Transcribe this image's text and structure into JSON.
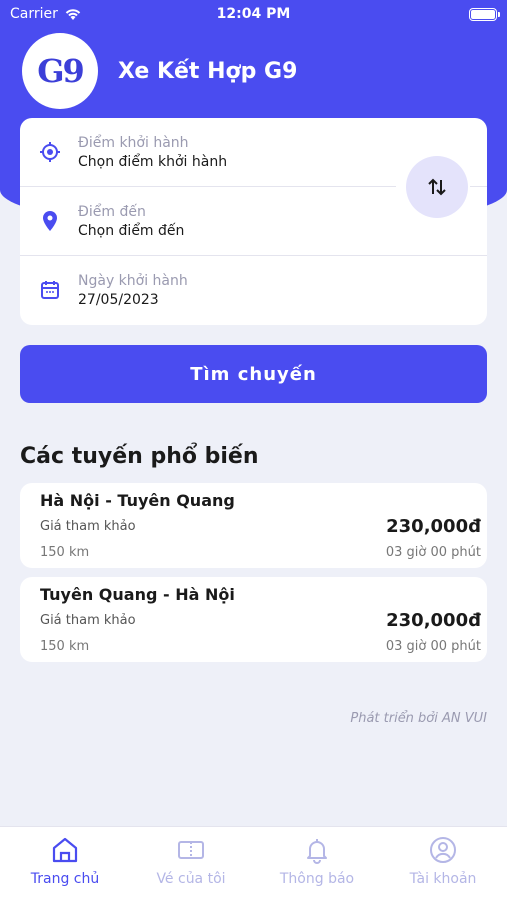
{
  "status_bar": {
    "carrier": "Carrier",
    "time": "12:04 PM"
  },
  "header": {
    "logo_text": "G9",
    "title": "Xe Kết Hợp G9"
  },
  "search": {
    "origin": {
      "label": "Điểm khởi hành",
      "value": "Chọn điểm khởi hành",
      "icon": "target-icon"
    },
    "destination": {
      "label": "Điểm đến",
      "value": "Chọn điểm đến",
      "icon": "location-pin-icon"
    },
    "date": {
      "label": "Ngày khởi hành",
      "value": "27/05/2023",
      "icon": "calendar-icon"
    },
    "swap_icon": "swap-arrows-icon",
    "button_label": "Tìm chuyến"
  },
  "popular": {
    "title": "Các tuyến phổ biến",
    "routes": [
      {
        "name": "Hà Nội - Tuyên Quang",
        "price_label": "Giá tham khảo",
        "price": "230,000đ",
        "distance": "150 km",
        "duration": "03 giờ 00 phút"
      },
      {
        "name": "Tuyên Quang - Hà Nội",
        "price_label": "Giá tham khảo",
        "price": "230,000đ",
        "distance": "150 km",
        "duration": "03 giờ 00 phút"
      }
    ]
  },
  "footer_note": "Phát triển bởi AN VUI",
  "tabbar": {
    "items": [
      {
        "label": "Trang chủ",
        "icon": "home-icon",
        "active": true
      },
      {
        "label": "Vé của tôi",
        "icon": "ticket-icon",
        "active": false
      },
      {
        "label": "Thông báo",
        "icon": "bell-icon",
        "active": false
      },
      {
        "label": "Tài khoản",
        "icon": "user-icon",
        "active": false
      }
    ]
  },
  "colors": {
    "primary": "#4a4cf0",
    "background": "#eef0f8",
    "inactive_tab": "#b4b6e6"
  }
}
